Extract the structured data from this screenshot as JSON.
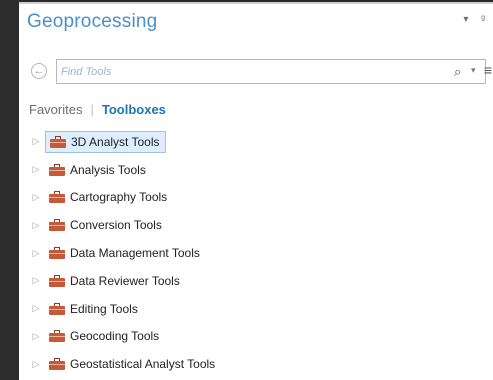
{
  "pane": {
    "title": "Geoprocessing",
    "pin_glyph": "▾",
    "close_glyph": "ᵍ"
  },
  "search": {
    "back_glyph": "←",
    "placeholder": "Find Tools",
    "search_glyph": "⌕",
    "dropdown_glyph": "▾",
    "menu_glyph": "≡"
  },
  "tabs": {
    "favorites": "Favorites",
    "separator": "|",
    "toolboxes": "Toolboxes"
  },
  "tree": {
    "expander_glyph": "▷",
    "items": [
      {
        "label": "3D Analyst Tools",
        "selected": true
      },
      {
        "label": "Analysis Tools"
      },
      {
        "label": "Cartography Tools"
      },
      {
        "label": "Conversion Tools"
      },
      {
        "label": "Data Management Tools"
      },
      {
        "label": "Data Reviewer Tools"
      },
      {
        "label": "Editing Tools"
      },
      {
        "label": "Geocoding Tools"
      },
      {
        "label": "Geostatistical Analyst Tools"
      }
    ]
  },
  "colors": {
    "title": "#4a90c8",
    "toolboxes_tab": "#1f74b6",
    "selection_bg": "#ddeeff",
    "selection_border": "#9dc2e4",
    "toolbox_icon": "#c55a3a"
  }
}
